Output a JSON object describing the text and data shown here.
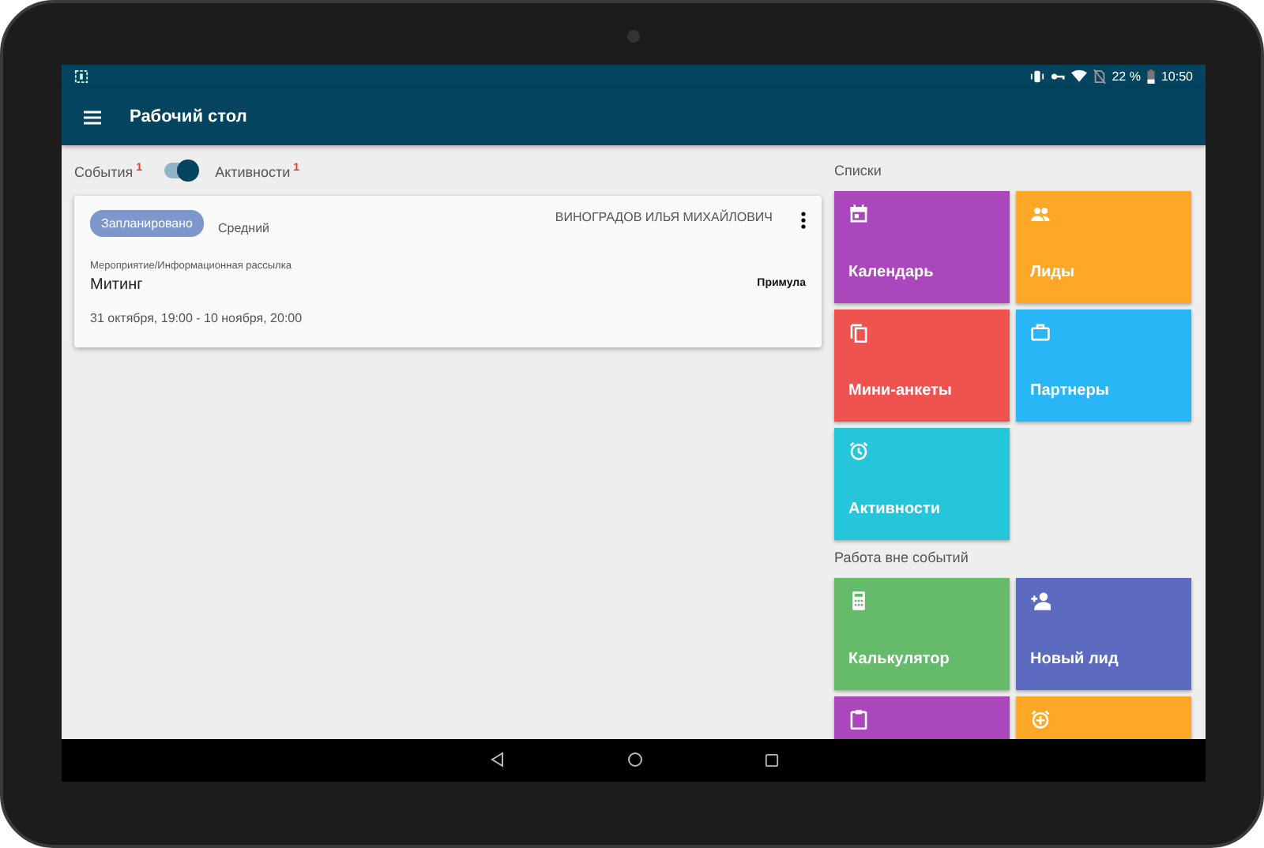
{
  "status_bar": {
    "battery": "22 %",
    "time": "10:50"
  },
  "app_bar": {
    "title": "Рабочий стол"
  },
  "filter": {
    "left_label": "События",
    "left_badge": "1",
    "toggle_on": true,
    "right_label": "Активности",
    "right_badge": "1"
  },
  "events": [
    {
      "status": "Запланировано",
      "priority": "Средний",
      "owner": "ВИНОГРАДОВ ИЛЬЯ МИХАЙЛОВИЧ",
      "type": "Мероприятие/Информационная рассылка",
      "title": "Митинг",
      "place": "Примула",
      "dates": "31 октября, 19:00 - 10 ноября, 20:00"
    }
  ],
  "sections": [
    {
      "title": "Списки",
      "tiles": [
        {
          "kind": "calendar",
          "label": "Календарь",
          "color": "#ab47bc"
        },
        {
          "kind": "people",
          "label": "Лиды",
          "color": "#ffa726"
        },
        {
          "kind": "copy",
          "label": "Мини-анкеты",
          "color": "#ef5350"
        },
        {
          "kind": "briefcase",
          "label": "Партнеры",
          "color": "#29b6f6"
        },
        {
          "kind": "alarm",
          "label": "Активности",
          "color": "#26c6da"
        }
      ]
    },
    {
      "title": "Работа вне событий",
      "tiles": [
        {
          "kind": "calculator",
          "label": "Калькулятор",
          "color": "#66bb6a"
        },
        {
          "kind": "person-add",
          "label": "Новый лид",
          "color": "#5c6bc0"
        },
        {
          "kind": "clipboard",
          "color": "#ab47bc"
        },
        {
          "kind": "alarm-add",
          "color": "#ffa726"
        }
      ]
    }
  ]
}
